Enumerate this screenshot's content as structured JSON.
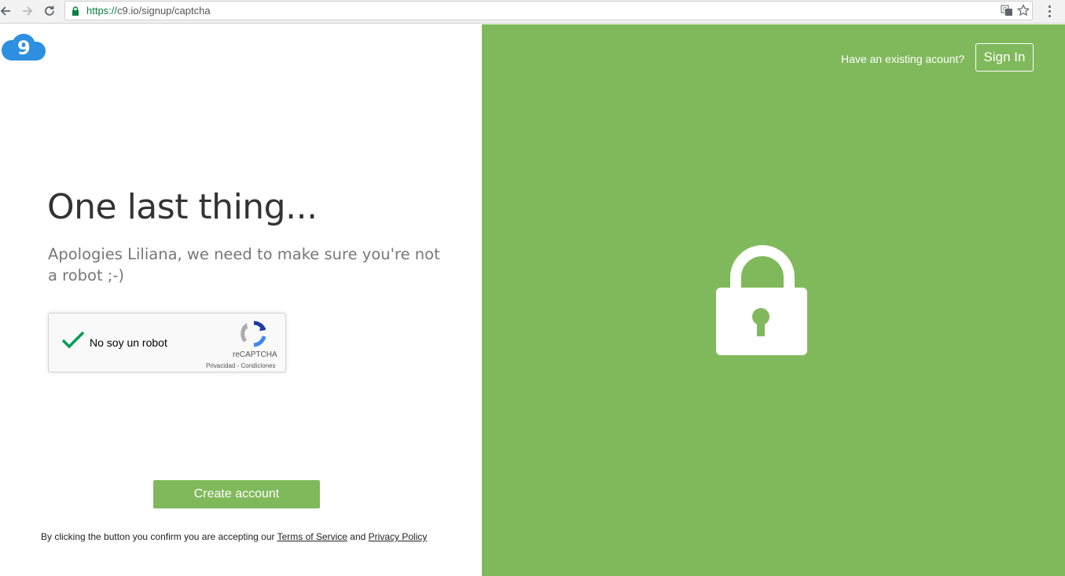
{
  "browser": {
    "url_scheme": "https://",
    "url_rest": "c9.io/signup/captcha",
    "back_icon": "back-arrow-icon",
    "forward_icon": "forward-arrow-icon",
    "reload_icon": "reload-icon",
    "secure_icon": "lock-icon",
    "translate_icon": "translate-icon",
    "bookmark_icon": "star-icon",
    "menu_icon": "kebab-menu-icon"
  },
  "left": {
    "logo_icon": "cloud9-logo-icon",
    "heading": "One last thing...",
    "subtext": "Apologies Liliana, we need to make sure you're not a robot ;-)",
    "captcha": {
      "label": "No soy un robot",
      "brand": "reCAPTCHA",
      "links": "Privacidad - Condiciones",
      "checked": true
    },
    "create_button": "Create account",
    "terms": {
      "prefix": "By clicking the button you confirm you are accepting our ",
      "tos": "Terms of Service",
      "and": " and ",
      "privacy": "Privacy Policy"
    }
  },
  "right": {
    "existing_prompt": "Have an existing acount?",
    "signin_button": "Sign In",
    "icon": "padlock-icon",
    "background": "#80b95b"
  },
  "colors": {
    "accent": "#80b95b",
    "button": "#7fb95b",
    "logo": "#2c8fe0",
    "check": "#009e55"
  }
}
